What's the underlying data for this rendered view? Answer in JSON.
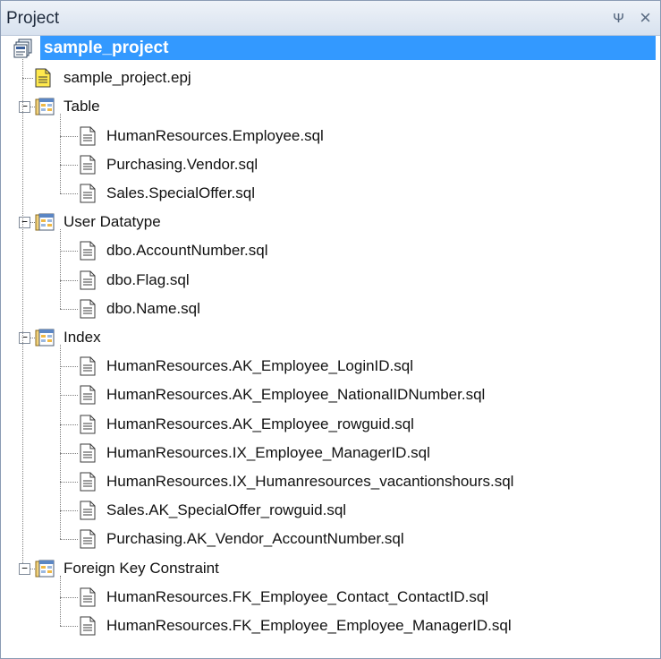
{
  "panel": {
    "title": "Project",
    "pin_glyph": "ᴪ",
    "close_glyph": "×"
  },
  "tree": {
    "root": {
      "label": "sample_project",
      "icon": "project-icon",
      "selected": true
    },
    "project_file": {
      "label": "sample_project.epj",
      "icon": "project-file-icon"
    },
    "toggle_glyph": "−",
    "groups": [
      {
        "label": "Table",
        "icon": "folder-icon",
        "expanded": true,
        "items": [
          "HumanResources.Employee.sql",
          "Purchasing.Vendor.sql",
          "Sales.SpecialOffer.sql"
        ]
      },
      {
        "label": "User Datatype",
        "icon": "folder-icon",
        "expanded": true,
        "items": [
          "dbo.AccountNumber.sql",
          "dbo.Flag.sql",
          "dbo.Name.sql"
        ]
      },
      {
        "label": "Index",
        "icon": "folder-icon",
        "expanded": true,
        "items": [
          "HumanResources.AK_Employee_LoginID.sql",
          "HumanResources.AK_Employee_NationalIDNumber.sql",
          "HumanResources.AK_Employee_rowguid.sql",
          "HumanResources.IX_Employee_ManagerID.sql",
          "HumanResources.IX_Humanresources_vacantionshours.sql",
          "Sales.AK_SpecialOffer_rowguid.sql",
          "Purchasing.AK_Vendor_AccountNumber.sql"
        ]
      },
      {
        "label": "Foreign Key Constraint",
        "icon": "folder-icon",
        "expanded": true,
        "items": [
          "HumanResources.FK_Employee_Contact_ContactID.sql",
          "HumanResources.FK_Employee_Employee_ManagerID.sql"
        ]
      }
    ]
  },
  "colors": {
    "selection": "#3399ff",
    "title_bar": "#dfe7f2",
    "file_icon_yellow": "#ffe94d"
  }
}
